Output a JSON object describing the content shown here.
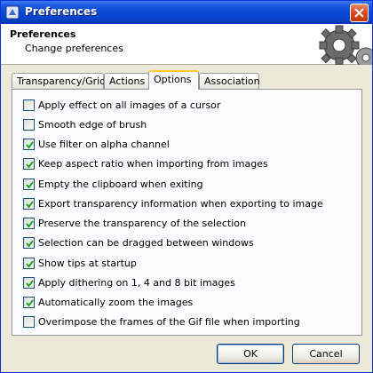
{
  "window": {
    "title": "Preferences"
  },
  "header": {
    "title": "Preferences",
    "subtitle": "Change preferences"
  },
  "tabs": [
    {
      "label": "Transparency/Grid",
      "active": false
    },
    {
      "label": "Actions",
      "active": false
    },
    {
      "label": "Options",
      "active": true
    },
    {
      "label": "Association",
      "active": false
    }
  ],
  "options": [
    {
      "label": "Apply effect on all images of a cursor",
      "checked": false
    },
    {
      "label": "Smooth edge of brush",
      "checked": false
    },
    {
      "label": "Use filter on alpha channel",
      "checked": true
    },
    {
      "label": "Keep aspect ratio when importing from images",
      "checked": true
    },
    {
      "label": "Empty the clipboard when exiting",
      "checked": true
    },
    {
      "label": "Export transparency information when exporting to image",
      "checked": true
    },
    {
      "label": "Preserve the transparency of the selection",
      "checked": true
    },
    {
      "label": "Selection can be dragged between windows",
      "checked": true
    },
    {
      "label": "Show tips at startup",
      "checked": true
    },
    {
      "label": "Apply dithering on 1, 4 and 8 bit images",
      "checked": true
    },
    {
      "label": "Automatically zoom the images",
      "checked": true
    },
    {
      "label": "Overimpose the frames of the Gif file when importing",
      "checked": false
    }
  ],
  "buttons": {
    "ok": "OK",
    "cancel": "Cancel"
  },
  "icons": {
    "title": "app-icon",
    "close": "close-icon",
    "header": "gears-icon",
    "check": "check-icon"
  },
  "colors": {
    "titlebar": "#0a48d6",
    "dialog": "#ece9d8",
    "panel": "#fcfcfe",
    "active_tab": "#ffc83c",
    "checkbox_border": "#1c5180",
    "check": "#21a121"
  }
}
